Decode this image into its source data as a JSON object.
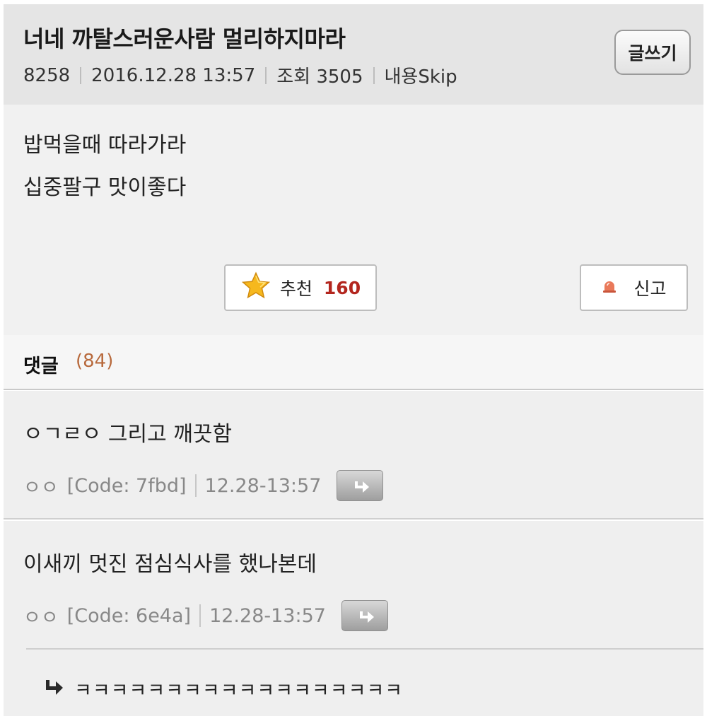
{
  "post": {
    "title": "너네 까탈스러운사람 멀리하지마라",
    "number": "8258",
    "datetime": "2016.12.28 13:57",
    "views": "조회 3505",
    "skip_label": "내용Skip",
    "write_label": "글쓰기",
    "body_lines": [
      "밥먹을때 따라가라",
      "십중팔구 맛이좋다"
    ],
    "recommend_label": "추천",
    "recommend_count": "160",
    "report_label": "신고"
  },
  "comments": {
    "title": "댓글",
    "count": "(84)",
    "items": [
      {
        "text": "ㅇㄱㄹㅇ 그리고 깨끗함",
        "author": "ㅇㅇ",
        "code": "[Code: 7fbd]",
        "time": "12.28-13:57"
      },
      {
        "text": "이새끼 멋진 점심식사를 했나본데",
        "author": "ㅇㅇ",
        "code": "[Code: 6e4a]",
        "time": "12.28-13:57"
      }
    ],
    "reply": {
      "text": "ㅋㅋㅋㅋㅋㅋㅋㅋㅋㅋㅋㅋㅋㅋㅋㅋㅋㅋ"
    }
  },
  "colors": {
    "recommend_count": "#b3261e",
    "comment_count": "#b86a3d",
    "header_bg": "#e5e5e5"
  },
  "icons": {
    "recommend": "star-icon",
    "report": "siren-icon",
    "reply_button": "reply-arrow-icon",
    "reply_marker": "reply-arrow-icon"
  }
}
